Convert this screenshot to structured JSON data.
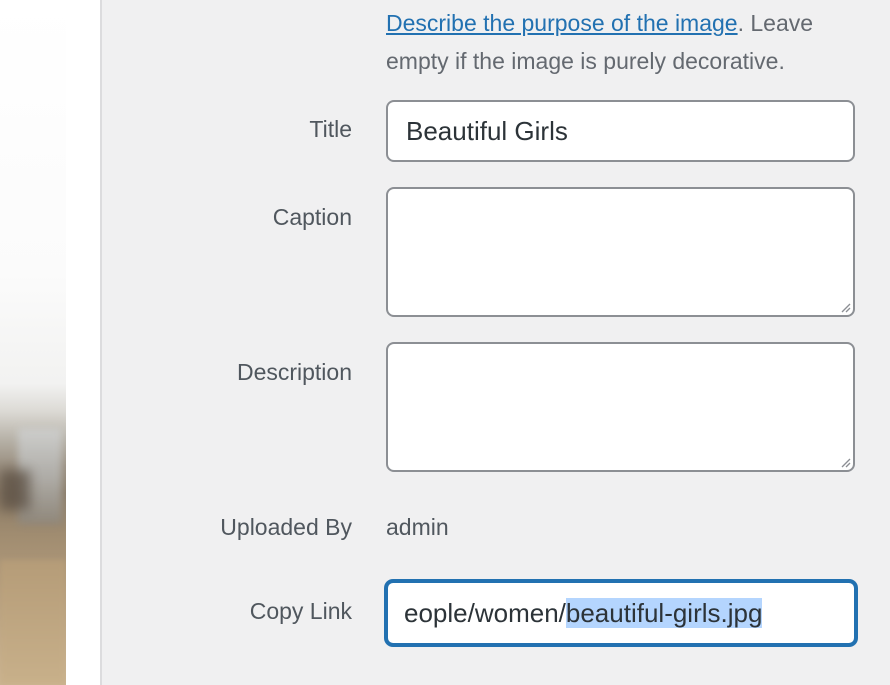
{
  "help": {
    "link_text": "Describe the purpose of the image",
    "rest_text": ". Leave empty if the image is purely decorative."
  },
  "fields": {
    "title": {
      "label": "Title",
      "value": "Beautiful Girls"
    },
    "caption": {
      "label": "Caption",
      "value": ""
    },
    "description": {
      "label": "Description",
      "value": ""
    },
    "uploaded_by": {
      "label": "Uploaded By",
      "value": "admin"
    },
    "copy_link": {
      "label": "Copy Link",
      "value_before_selection": "eople/women/",
      "value_selected": "beautiful-girls.jpg"
    }
  },
  "colors": {
    "link": "#2271b1",
    "focus_border": "#2271b1",
    "selection": "#b4d5fe",
    "label": "#50575e"
  }
}
